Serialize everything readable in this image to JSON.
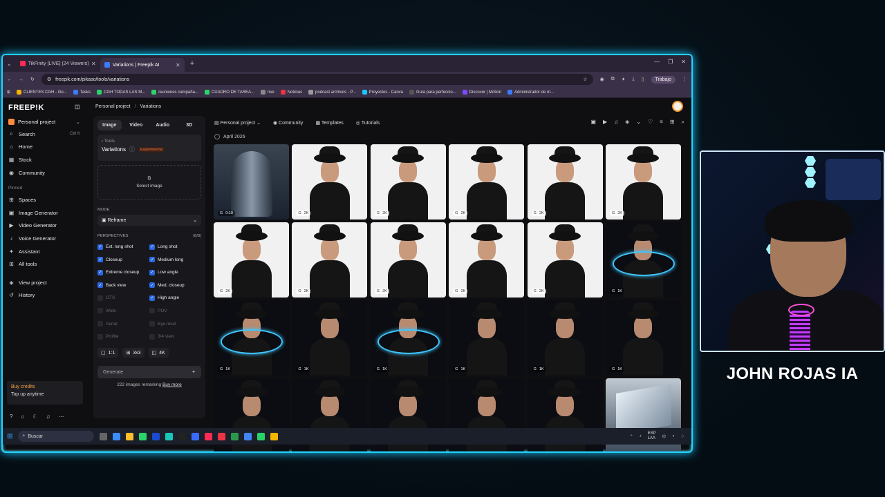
{
  "tabs": [
    {
      "label": "TikFinity [LIVE] (24 Viewers)",
      "color": "#ff2a55"
    },
    {
      "label": "Variations | Freepik AI",
      "color": "#3a7bff"
    }
  ],
  "url": "freepik.com/pikaso/tools/variations",
  "profile": "Trabajo",
  "bookmarks": [
    "CLIENTES CGH - Go...",
    "Tasks",
    "CGH TODAS LAS M...",
    "reuniones campaña...",
    "CUADRO DE TAREA...",
    "rive",
    "Noticias",
    "podcast archivos - P...",
    "Proyectos - Canva",
    "Guía para perfeccio...",
    "Discover | Motion",
    "Administrador de m..."
  ],
  "sidebar": {
    "logo": "FREEP!K",
    "project": "Personal project",
    "nav": [
      {
        "label": "Search",
        "shortcut": "Ctrl K",
        "icon": "⌕"
      },
      {
        "label": "Home",
        "icon": "⌂"
      },
      {
        "label": "Stock",
        "icon": "▦"
      },
      {
        "label": "Community",
        "icon": "◉"
      }
    ],
    "pinned_label": "Pinned",
    "pinned": [
      {
        "label": "Spaces",
        "icon": "⊞"
      },
      {
        "label": "Image Generator",
        "icon": "▣"
      },
      {
        "label": "Video Generator",
        "icon": "▶"
      },
      {
        "label": "Voice Generator",
        "icon": "♪"
      },
      {
        "label": "Assistant",
        "icon": "✦"
      },
      {
        "label": "All tools",
        "icon": "⊞"
      }
    ],
    "extra": [
      {
        "label": "View project",
        "icon": "◈"
      },
      {
        "label": "History",
        "icon": "↺"
      }
    ],
    "credits_title": "Buy credits",
    "credits_sub": "Top up anytime"
  },
  "breadcrumb": {
    "project": "Personal project",
    "sep": "/",
    "page": "Variations"
  },
  "panel": {
    "tabs": [
      "Image",
      "Video",
      "Audio",
      "3D"
    ],
    "tools_label": "Tools",
    "tool_name": "Variations",
    "experimental": "Experimental",
    "select_image": "Select image",
    "mode_label": "MODE",
    "mode_value": "Reframe",
    "perspectives_label": "PERSPECTIVES",
    "perspectives_count": "(8/8)",
    "checks": [
      {
        "label": "Ext. long shot",
        "on": true
      },
      {
        "label": "Long shot",
        "on": true
      },
      {
        "label": "Closeup",
        "on": true
      },
      {
        "label": "Medium long",
        "on": true
      },
      {
        "label": "Extreme closeup",
        "on": true
      },
      {
        "label": "Low angle",
        "on": true
      },
      {
        "label": "Back view",
        "on": true
      },
      {
        "label": "Med. closeup",
        "on": true
      },
      {
        "label": "OTS",
        "on": false
      },
      {
        "label": "High angle",
        "on": true
      },
      {
        "label": "Wide",
        "on": false
      },
      {
        "label": "POV",
        "on": false
      },
      {
        "label": "Aerial",
        "on": false
      },
      {
        "label": "Eye level",
        "on": false
      },
      {
        "label": "Profile",
        "on": false
      },
      {
        "label": "3/4 view",
        "on": false
      }
    ],
    "ratio": "1:1",
    "grid": "3x3",
    "quality": "4K",
    "generate": "Generate",
    "remaining": "222 images remaining",
    "buy_more": "Buy more"
  },
  "gallery_header": {
    "project": "Personal project",
    "community": "Community",
    "templates": "Templates",
    "tutorials": "Tutorials"
  },
  "date_label": "April 2026",
  "cells": [
    {
      "kind": "metal",
      "badge": "0:10"
    },
    {
      "kind": "white",
      "badge": "2K"
    },
    {
      "kind": "white",
      "badge": "2K"
    },
    {
      "kind": "white",
      "badge": "2K"
    },
    {
      "kind": "white",
      "badge": "2K"
    },
    {
      "kind": "white",
      "badge": "2K"
    },
    {
      "kind": "white",
      "badge": "2K"
    },
    {
      "kind": "white",
      "badge": "2K"
    },
    {
      "kind": "white",
      "badge": "2K"
    },
    {
      "kind": "white",
      "badge": "2K"
    },
    {
      "kind": "white",
      "badge": "2K"
    },
    {
      "kind": "dark",
      "badge": "1K"
    },
    {
      "kind": "dark",
      "badge": "1K"
    },
    {
      "kind": "dark",
      "badge": "1K"
    },
    {
      "kind": "dark",
      "badge": "1K"
    },
    {
      "kind": "dark",
      "badge": "1K"
    },
    {
      "kind": "dark",
      "badge": "1K"
    },
    {
      "kind": "dark",
      "badge": "1K"
    },
    {
      "kind": "dark",
      "badge": ""
    },
    {
      "kind": "dark",
      "badge": ""
    },
    {
      "kind": "dark",
      "badge": ""
    },
    {
      "kind": "dark",
      "badge": ""
    },
    {
      "kind": "dark",
      "badge": ""
    },
    {
      "kind": "glass",
      "badge": ""
    }
  ],
  "taskbar": {
    "search": "Buscar",
    "lang": "ESP",
    "region": "LAA"
  },
  "streamer": "JOHN ROJAS IA"
}
